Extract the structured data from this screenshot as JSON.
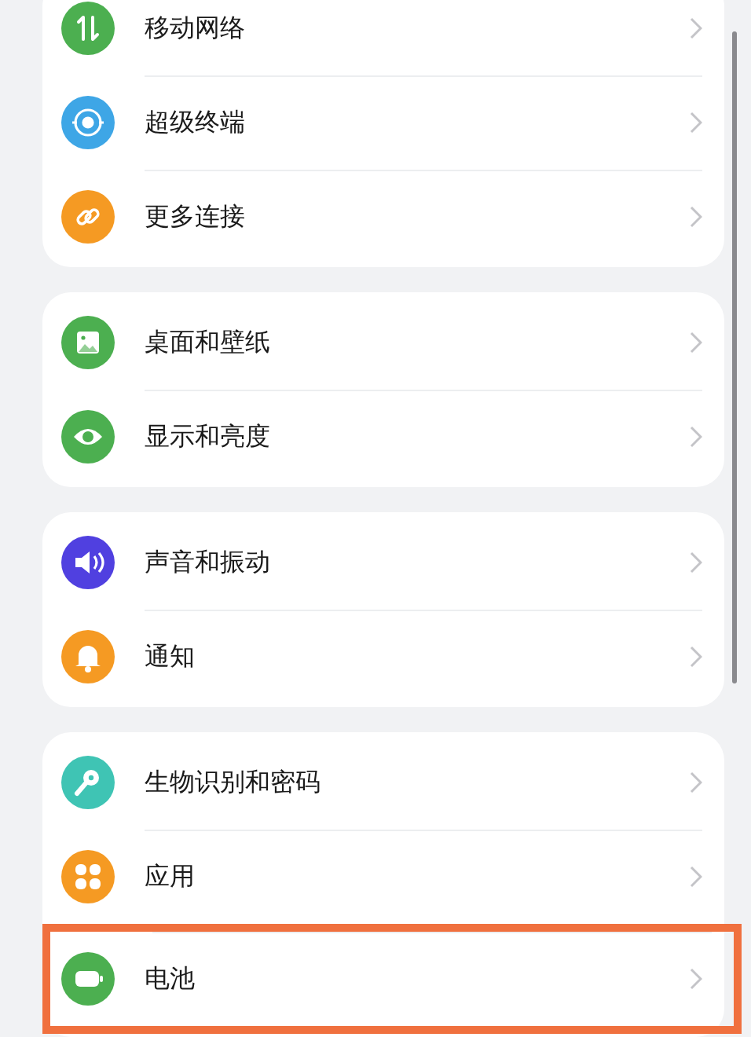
{
  "groups": [
    {
      "items": [
        {
          "label": "移动网络",
          "kind": "network",
          "color": "#4caf50",
          "highlighted": false
        },
        {
          "label": "超级终端",
          "kind": "devices",
          "color": "#3ea6e6",
          "highlighted": false
        },
        {
          "label": "更多连接",
          "kind": "link",
          "color": "#f59a23",
          "highlighted": false
        }
      ]
    },
    {
      "items": [
        {
          "label": "桌面和壁纸",
          "kind": "wallpaper",
          "color": "#4caf50",
          "highlighted": false
        },
        {
          "label": "显示和亮度",
          "kind": "display",
          "color": "#4caf50",
          "highlighted": false
        }
      ]
    },
    {
      "items": [
        {
          "label": "声音和振动",
          "kind": "sound",
          "color": "#5040e0",
          "highlighted": false
        },
        {
          "label": "通知",
          "kind": "bell",
          "color": "#f59a23",
          "highlighted": false
        }
      ]
    },
    {
      "items": [
        {
          "label": "生物识别和密码",
          "kind": "key",
          "color": "#3fc4b4",
          "highlighted": false
        },
        {
          "label": "应用",
          "kind": "apps",
          "color": "#f59a23",
          "highlighted": false
        },
        {
          "label": "电池",
          "kind": "battery",
          "color": "#4caf50",
          "highlighted": true
        }
      ]
    }
  ]
}
